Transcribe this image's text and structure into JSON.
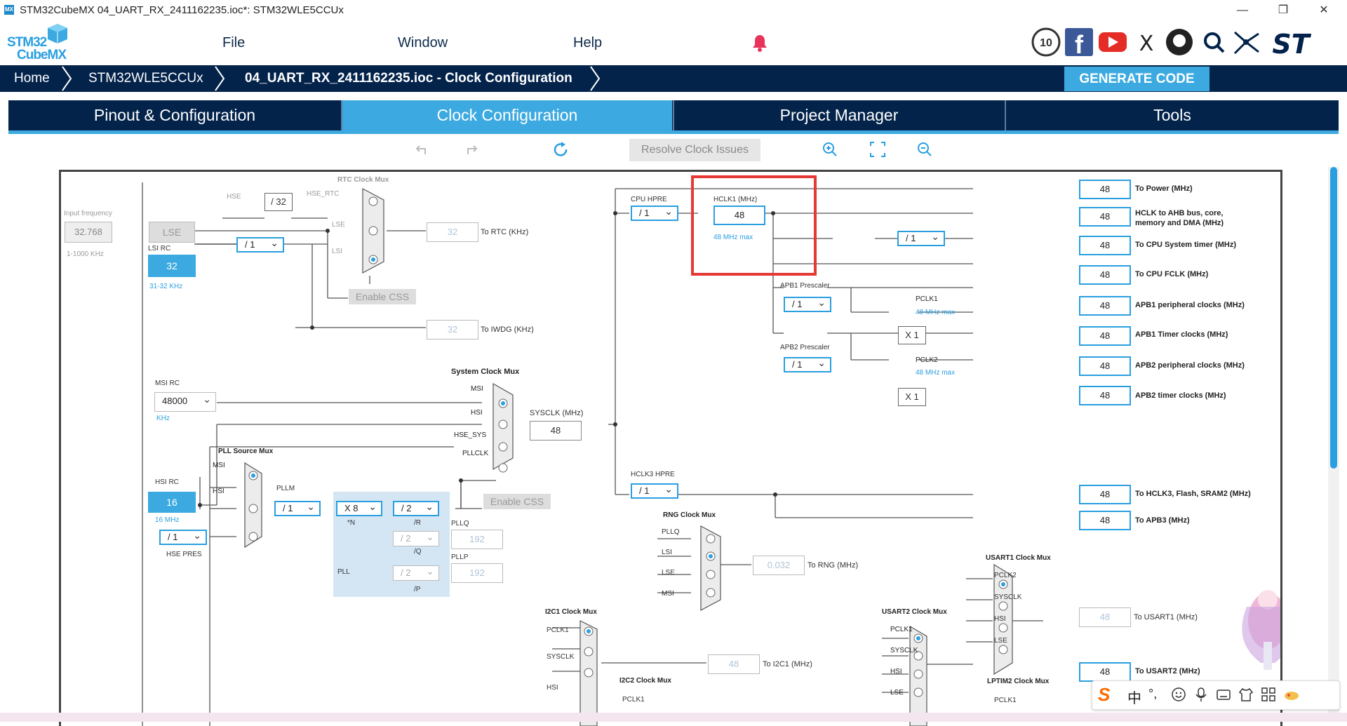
{
  "window": {
    "app_icon": "MX",
    "title": "STM32CubeMX 04_UART_RX_2411162235.ioc*: STM32WLE5CCUx",
    "minimize": "—",
    "maximize": "❐",
    "close": "✕"
  },
  "logo": {
    "line1": "STM32",
    "line2": "CubeMX"
  },
  "menu": {
    "file": "File",
    "window": "Window",
    "help": "Help"
  },
  "breadcrumb": {
    "home": "Home",
    "device": "STM32WLE5CCUx",
    "project": "04_UART_RX_2411162235.ioc - Clock Configuration"
  },
  "generate_code": "GENERATE CODE",
  "tabs": [
    "Pinout & Configuration",
    "Clock Configuration",
    "Project Manager",
    "Tools"
  ],
  "toolbar": {
    "resolve": "Resolve Clock Issues"
  },
  "diagram": {
    "input_frequency": "Input frequency",
    "lse_value": "32.768",
    "lse_range": "1-1000 KHz",
    "lse_label": "LSE",
    "lsi_rc": "LSI RC",
    "lsi_value": "32",
    "lsi_range": "31-32 KHz",
    "lsi_div": "/ 1",
    "hse": "HSE",
    "hse_div32": "/ 32",
    "hse_rtc": "HSE_RTC",
    "rtc_mux": "RTC Clock Mux",
    "mux_lse": "LSE",
    "mux_lsi": "LSI",
    "enable_css": "Enable CSS",
    "rtc_value": "32",
    "to_rtc": "To RTC (KHz)",
    "iwdg_value": "32",
    "to_iwdg": "To IWDG (KHz)",
    "msi_rc": "MSI RC",
    "msi_value": "48000",
    "khz": "KHz",
    "hsi_rc": "HSI RC",
    "hsi_value": "16",
    "hsi_mhz": "16 MHz",
    "hse_pres_div": "/ 1",
    "hse_pres": "HSE PRES",
    "pll_source_mux": "PLL Source Mux",
    "msi": "MSI",
    "hsi": "HSI",
    "pllm": "PLLM",
    "pllm_div": "/ 1",
    "pll_n": "X 8",
    "n_label": "*N",
    "pll_r": "/ 2",
    "r_label": "/R",
    "pll_q": "/ 2",
    "q_label": "/Q",
    "pll_p": "/ 2",
    "p_label": "/P",
    "pll": "PLL",
    "pllq": "PLLQ",
    "pllq_value": "192",
    "pllp": "PLLP",
    "pllp_value": "192",
    "sys_mux": "System Clock Mux",
    "hse_sys": "HSE_SYS",
    "pllclk": "PLLCLK",
    "sysclk": "SYSCLK (MHz)",
    "sysclk_value": "48",
    "cpu_hpre": "CPU HPRE",
    "cpu_hpre_div": "/ 1",
    "hclk1": "HCLK1 (MHz)",
    "hclk1_value": "48",
    "hclk1_max": "48 MHz max",
    "cpu_timer_div": "/ 1",
    "apb1_prescaler": "APB1 Prescaler",
    "apb1_div": "/ 1",
    "pclk1": "PCLK1",
    "pclk1_max": "48 MHz max",
    "x1a": "X 1",
    "apb2_prescaler": "APB2 Prescaler",
    "apb2_div": "/ 1",
    "pclk2": "PCLK2",
    "pclk2_max": "48 MHz max",
    "x1b": "X 1",
    "hclk3_hpre": "HCLK3 HPRE",
    "hclk3_div": "/ 1",
    "outputs": [
      {
        "value": "48",
        "label": "To Power (MHz)"
      },
      {
        "value": "48",
        "label": "HCLK to AHB bus, core, memory and DMA (MHz)"
      },
      {
        "value": "48",
        "label": "To CPU System timer (MHz)"
      },
      {
        "value": "48",
        "label": "To CPU FCLK (MHz)"
      },
      {
        "value": "48",
        "label": "APB1 peripheral clocks (MHz)"
      },
      {
        "value": "48",
        "label": "APB1 Timer clocks (MHz)"
      },
      {
        "value": "48",
        "label": "APB2 peripheral clocks (MHz)"
      },
      {
        "value": "48",
        "label": "APB2 timer clocks (MHz)"
      },
      {
        "value": "48",
        "label": "To HCLK3, Flash, SRAM2 (MHz)"
      },
      {
        "value": "48",
        "label": "To APB3 (MHz)"
      }
    ],
    "rng_mux": "RNG Clock Mux",
    "rng_inputs": [
      "PLLQ",
      "LSI",
      "LSE",
      "MSI"
    ],
    "rng_value": "0.032",
    "to_rng": "To RNG (MHz)",
    "i2c1_mux": "I2C1 Clock Mux",
    "i2c1_inputs": [
      "PCLK1",
      "SYSCLK",
      "HSI"
    ],
    "i2c1_value": "48",
    "to_i2c1": "To I2C1 (MHz)",
    "i2c2_mux": "I2C2 Clock Mux",
    "i2c2_pclk1": "PCLK1",
    "usart1_mux": "USART1 Clock Mux",
    "usart1_inputs": [
      "PCLK2",
      "SYSCLK",
      "HSI",
      "LSE"
    ],
    "usart1_value": "48",
    "to_usart1": "To USART1 (MHz)",
    "usart2_mux": "USART2 Clock Mux",
    "usart2_inputs": [
      "PCLK1",
      "SYSCLK",
      "HSI",
      "LSE"
    ],
    "usart2_value": "48",
    "to_usart2": "To USART2 (MHz)",
    "lptim2_mux": "LPTIM2 Clock Mux",
    "lptim2_pclk1": "PCLK1"
  },
  "ime": {
    "s": "S",
    "zh": "中",
    "punct": "°,"
  },
  "colors": {
    "navy": "#03234b",
    "accent": "#3caae0",
    "highlight": "#e53935"
  }
}
